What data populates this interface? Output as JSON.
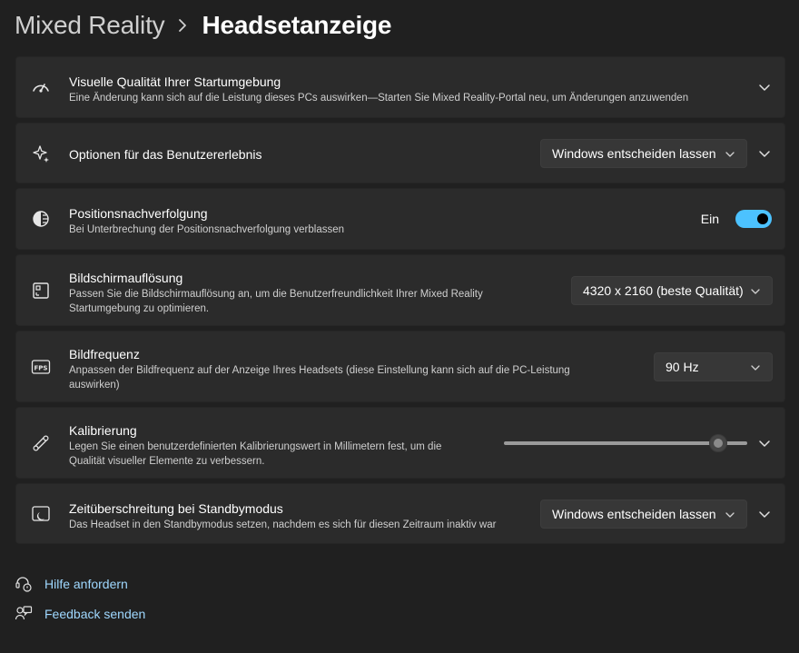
{
  "breadcrumb": {
    "parent": "Mixed Reality",
    "current": "Headsetanzeige"
  },
  "cards": {
    "visual_quality": {
      "title": "Visuelle Qualität Ihrer Startumgebung",
      "desc": "Eine Änderung kann sich auf die Leistung dieses PCs auswirken—Starten Sie Mixed Reality-Portal neu, um Änderungen anzuwenden",
      "icon": "speedometer-icon"
    },
    "experience": {
      "title": "Optionen für das Benutzererlebnis",
      "select_value": "Windows entscheiden lassen",
      "icon": "sparkle-icon"
    },
    "tracking": {
      "title": "Positionsnachverfolgung",
      "desc": "Bei Unterbrechung der Positionsnachverfolgung verblassen",
      "toggle_label": "Ein",
      "toggle_on": true,
      "icon": "tracking-icon"
    },
    "resolution": {
      "title": "Bildschirmauflösung",
      "desc_line1": "Passen Sie die Bildschirmauflösung an, um die Benutzerfreundlichkeit Ihrer Mixed Reality",
      "desc_line2": "Startumgebung zu optimieren.",
      "select_value": "4320 x 2160 (beste Qualität)",
      "icon": "resolution-icon"
    },
    "framerate": {
      "title": "Bildfrequenz",
      "desc_line1": "Anpassen der Bildfrequenz auf der Anzeige Ihres Headsets (diese Einstellung kann sich auf die PC-Leistung",
      "desc_line2": "auswirken)",
      "select_value": "90 Hz",
      "icon": "fps-icon",
      "icon_text": "FPS"
    },
    "calibration": {
      "title": "Kalibrierung",
      "desc_line1": "Legen Sie einen benutzerdefinierten Kalibrierungswert in Millimetern fest, um die",
      "desc_line2": "Qualität visueller Elemente zu verbessern.",
      "slider_fraction": 0.88,
      "icon": "ruler-icon"
    },
    "standby": {
      "title": "Zeitüberschreitung bei Standbymodus",
      "desc": "Das Headset in den Standbymodus setzen, nachdem es sich für diesen Zeitraum inaktiv war",
      "select_value": "Windows entscheiden lassen",
      "icon": "standby-icon"
    }
  },
  "footer": {
    "help": "Hilfe anfordern",
    "feedback": "Feedback senden"
  },
  "colors": {
    "accent": "#4cc2ff",
    "link": "#9fd8ff",
    "background": "#202020",
    "card": "#2b2b2b"
  }
}
